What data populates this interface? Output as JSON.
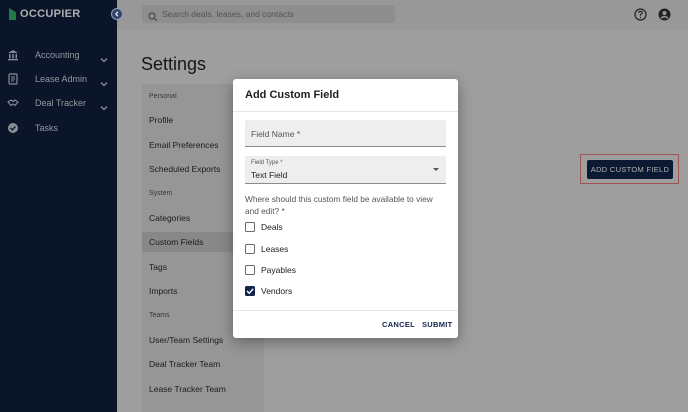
{
  "app": {
    "logo_text": "OCCUPIER"
  },
  "sidebar": {
    "items": [
      {
        "label": "Accounting",
        "icon": "bank-icon",
        "has_chevron": true
      },
      {
        "label": "Lease Admin",
        "icon": "document-icon",
        "has_chevron": true
      },
      {
        "label": "Deal Tracker",
        "icon": "handshake-icon",
        "has_chevron": true
      },
      {
        "label": "Tasks",
        "icon": "check-circle-icon",
        "has_chevron": false
      }
    ]
  },
  "topbar": {
    "search_placeholder": "Search deals, leases, and contacts",
    "icons": [
      "help-icon",
      "account-icon"
    ]
  },
  "page": {
    "title": "Settings"
  },
  "settings_menu": {
    "sections": [
      {
        "label": "Personal",
        "items": [
          "Profile",
          "Email Preferences",
          "Scheduled Exports"
        ]
      },
      {
        "label": "System",
        "items": [
          "Categories",
          "Custom Fields",
          "Tags",
          "Imports"
        ]
      },
      {
        "label": "Teams",
        "items": [
          "User/Team Settings",
          "Deal Tracker Team",
          "Lease Tracker Team"
        ]
      }
    ],
    "active_item": "Custom Fields"
  },
  "main": {
    "add_button_label": "ADD CUSTOM FIELD"
  },
  "modal": {
    "title": "Add Custom Field",
    "field_name_label": "Field Name *",
    "field_type_label": "Field Type *",
    "field_type_value": "Text Field",
    "question": "Where should this custom field be available to view and edit? *",
    "options": [
      {
        "label": "Deals",
        "checked": false
      },
      {
        "label": "Leases",
        "checked": false
      },
      {
        "label": "Payables",
        "checked": false
      },
      {
        "label": "Vendors",
        "checked": true
      }
    ],
    "cancel_label": "CANCEL",
    "submit_label": "SUBMIT"
  },
  "colors": {
    "sidebar_bg": "#0f1f3d",
    "accent": "#13254b",
    "logo_green": "#35b36c",
    "highlight_border": "#ef7d7d"
  }
}
